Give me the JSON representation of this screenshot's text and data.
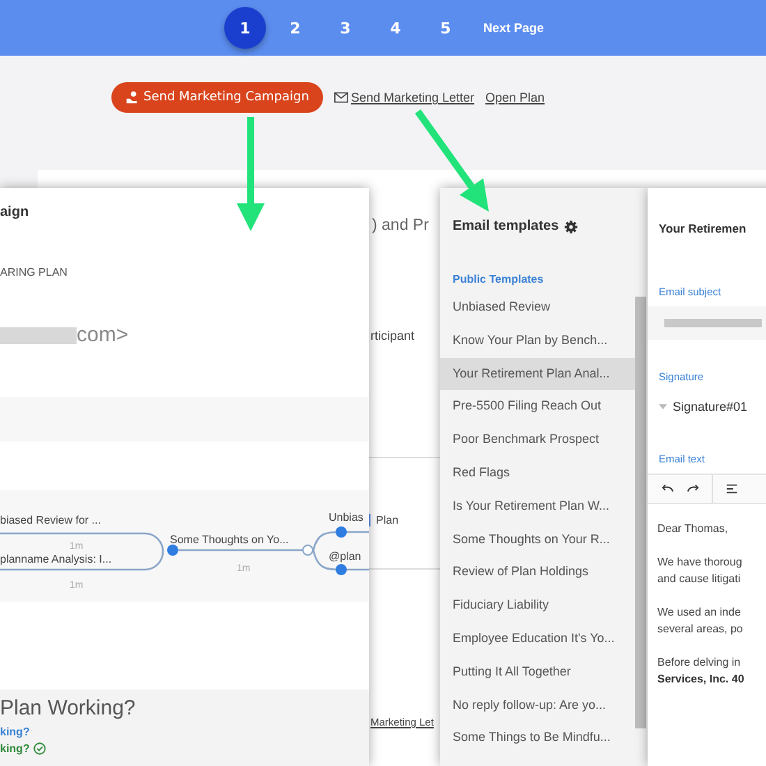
{
  "pagination": {
    "pages": [
      {
        "label": "1",
        "selected": true
      },
      {
        "label": "2",
        "selected": false
      },
      {
        "label": "3",
        "selected": false
      },
      {
        "label": "4",
        "selected": false
      },
      {
        "label": "5",
        "selected": false
      }
    ],
    "next": "Next Page"
  },
  "actions": {
    "campaign_button": "Send Marketing Campaign",
    "letter_link": "Send Marketing Letter",
    "open_plan_link": "Open Plan"
  },
  "background_page": {
    "heading": ") and Pr",
    "participant": "rticipant",
    "plan_field": "Plan",
    "letter_link": "Marketing Let"
  },
  "campaign_panel": {
    "title": "aign",
    "subtitle": "ARING PLAN",
    "email_end": "com>",
    "flow": {
      "first_label": "biased Review for ...",
      "second_label": "planname Analysis: I...",
      "delay_top": "1m",
      "delay_bottom": "1m",
      "middle_label": "Some Thoughts on Yo...",
      "middle_delay": "1m",
      "branch_top": "Unbias",
      "branch_bottom": "@plan"
    },
    "footer": {
      "heading": "Plan Working?",
      "link": "king?",
      "status": "king?",
      "done": true
    }
  },
  "templates_panel": {
    "title": "Email templates",
    "section": "Public Templates",
    "items": [
      {
        "label": "Unbiased Review",
        "selected": false
      },
      {
        "label": "Know Your Plan by Bench...",
        "selected": false
      },
      {
        "label": "Your Retirement Plan Anal...",
        "selected": true
      },
      {
        "label": "Pre-5500 Filing Reach Out",
        "selected": false
      },
      {
        "label": "Poor Benchmark Prospect",
        "selected": false
      },
      {
        "label": "Red Flags",
        "selected": false
      },
      {
        "label": "Is Your Retirement Plan W...",
        "selected": false
      },
      {
        "label": "Some Thoughts on Your R...",
        "selected": false
      },
      {
        "label": "Review of Plan Holdings",
        "selected": false
      },
      {
        "label": "Fiduciary Liability",
        "selected": false
      },
      {
        "label": "Employee Education It's Yo...",
        "selected": false
      },
      {
        "label": "Putting It All Together",
        "selected": false
      },
      {
        "label": "No reply follow-up: Are yo...",
        "selected": false
      },
      {
        "label": "Some Things to Be Mindfu...",
        "selected": false
      }
    ]
  },
  "editor_panel": {
    "title": "Your Retiremen",
    "subject_label": "Email subject",
    "signature_label": "Signature",
    "signature": "Signature#01",
    "text_label": "Email text",
    "body": [
      {
        "kind": "line",
        "text": "Dear Thomas,"
      },
      {
        "kind": "gap"
      },
      {
        "kind": "line",
        "text": "We have thoroug"
      },
      {
        "kind": "line",
        "text": "and cause litigati"
      },
      {
        "kind": "gap"
      },
      {
        "kind": "line",
        "text": "We used an inde"
      },
      {
        "kind": "line",
        "text": "several areas, po"
      },
      {
        "kind": "gap"
      },
      {
        "kind": "line",
        "text": "Before delving in"
      },
      {
        "kind": "bold",
        "text": "Services, Inc. 40"
      }
    ]
  }
}
